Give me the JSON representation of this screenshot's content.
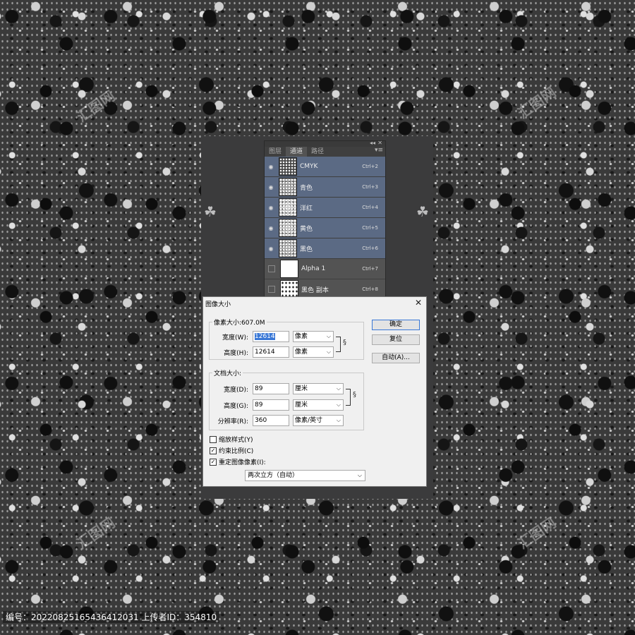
{
  "panel": {
    "tabs": [
      {
        "label": "图层"
      },
      {
        "label": "通道"
      },
      {
        "label": "路径"
      }
    ],
    "channels": [
      {
        "name": "CMYK",
        "shortcut": "Ctrl+2",
        "visible": true
      },
      {
        "name": "青色",
        "shortcut": "Ctrl+3",
        "visible": true
      },
      {
        "name": "洋红",
        "shortcut": "Ctrl+4",
        "visible": true
      },
      {
        "name": "黄色",
        "shortcut": "Ctrl+5",
        "visible": true
      },
      {
        "name": "黑色",
        "shortcut": "Ctrl+6",
        "visible": true
      },
      {
        "name": "Alpha 1",
        "shortcut": "Ctrl+7",
        "visible": false
      },
      {
        "name": "黑色 副本",
        "shortcut": "Ctrl+8",
        "visible": false
      }
    ]
  },
  "dialog": {
    "title": "图像大小",
    "pixel_dimensions_legend": "像素大小:607.0M",
    "width_label": "宽度(W):",
    "width_px": "12614",
    "width_px_unit": "像素",
    "height_label": "高度(H):",
    "height_px": "12614",
    "height_px_unit": "像素",
    "document_size_legend": "文档大小:",
    "doc_width_label": "宽度(D):",
    "doc_width": "89",
    "doc_width_unit": "厘米",
    "doc_height_label": "高度(G):",
    "doc_height": "89",
    "doc_height_unit": "厘米",
    "resolution_label": "分辨率(R):",
    "resolution": "360",
    "resolution_unit": "像素/英寸",
    "ok_label": "确定",
    "reset_label": "复位",
    "auto_label": "自动(A)...",
    "scale_styles_label": "缩放样式(Y)",
    "scale_styles_checked": false,
    "constrain_label": "约束比例(C)",
    "constrain_checked": true,
    "resample_label": "重定图像像素(I):",
    "resample_checked": true,
    "resample_method": "两次立方（自动）"
  },
  "footer": {
    "text": "编号：20220825165436412031 上传者ID：354810"
  }
}
